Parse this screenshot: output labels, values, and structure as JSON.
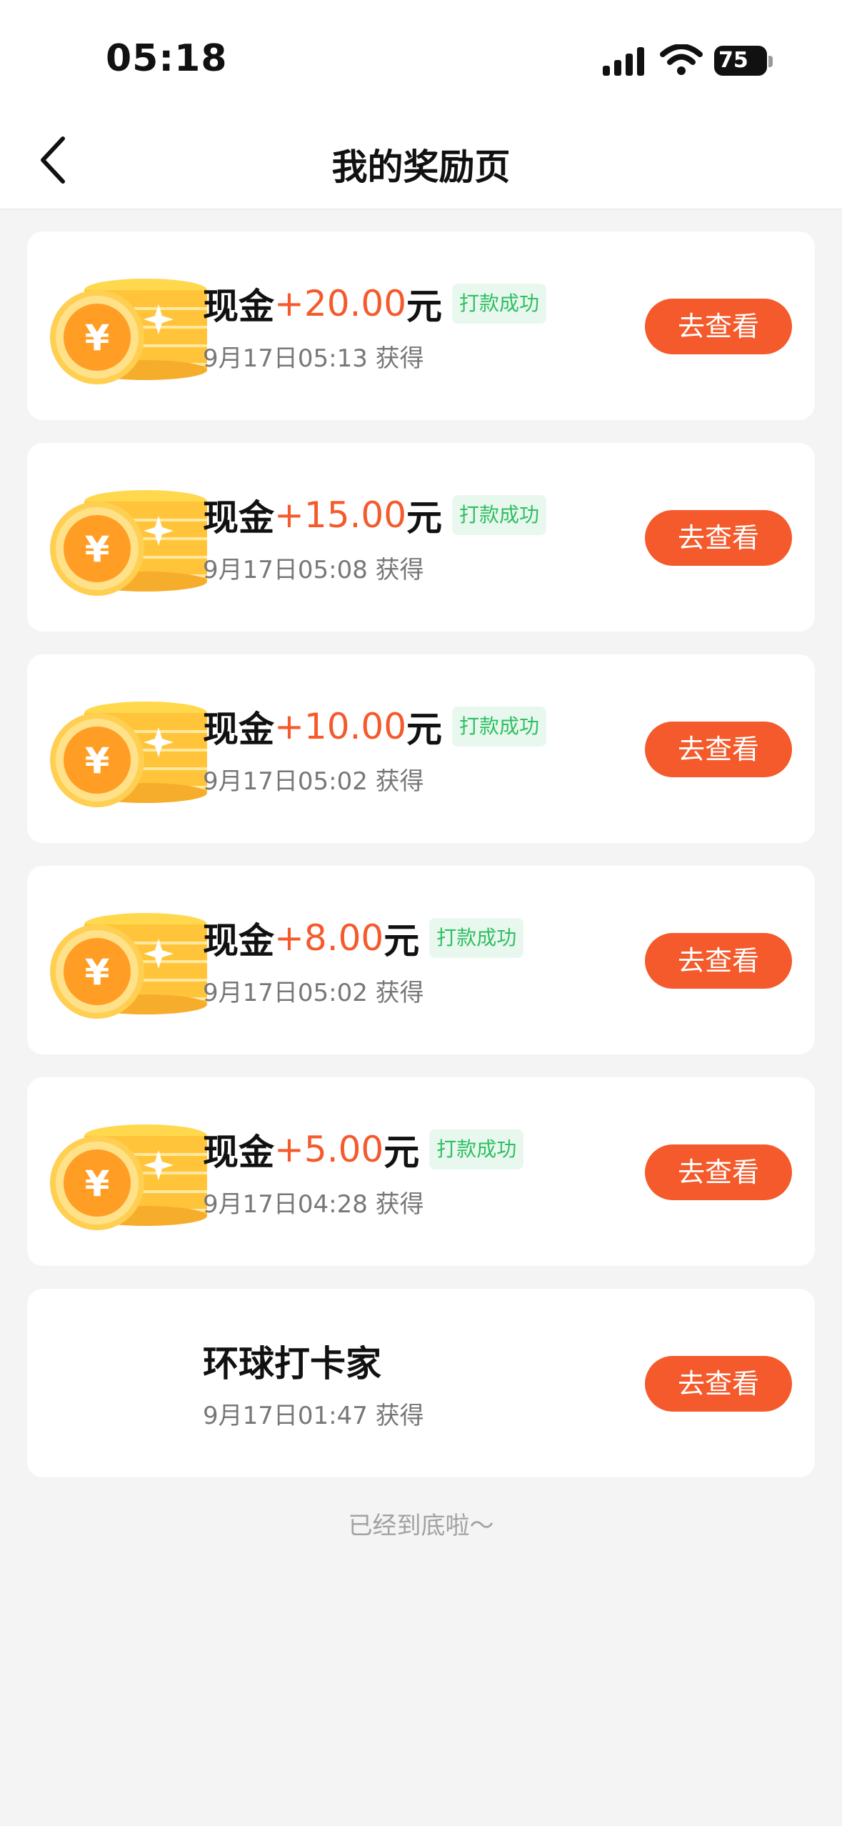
{
  "status_bar": {
    "time": "05:18",
    "battery_level": "75",
    "icons": [
      "signal-icon",
      "wifi-icon",
      "battery-icon"
    ]
  },
  "nav": {
    "title": "我的奖励页",
    "back_icon": "chevron-left-icon"
  },
  "colors": {
    "accent": "#f45a2b",
    "amount": "#f55a2c",
    "success_text": "#2fbf63",
    "success_bg": "#e9f8ee",
    "background": "#f4f4f4"
  },
  "rewards": [
    {
      "prefix": "现金",
      "amount": "+20.00",
      "suffix": "元",
      "status": "打款成功",
      "time": "9月17日05:13 获得",
      "button": "去查看",
      "icon": "gold-coin-icon"
    },
    {
      "prefix": "现金",
      "amount": "+15.00",
      "suffix": "元",
      "status": "打款成功",
      "time": "9月17日05:08 获得",
      "button": "去查看",
      "icon": "gold-coin-icon"
    },
    {
      "prefix": "现金",
      "amount": "+10.00",
      "suffix": "元",
      "status": "打款成功",
      "time": "9月17日05:02 获得",
      "button": "去查看",
      "icon": "gold-coin-icon"
    },
    {
      "prefix": "现金",
      "amount": "+8.00",
      "suffix": "元",
      "status": "打款成功",
      "time": "9月17日05:02 获得",
      "button": "去查看",
      "icon": "gold-coin-icon"
    },
    {
      "prefix": "现金",
      "amount": "+5.00",
      "suffix": "元",
      "status": "打款成功",
      "time": "9月17日04:28 获得",
      "button": "去查看",
      "icon": "gold-coin-icon"
    },
    {
      "title": "环球打卡家",
      "time": "9月17日01:47 获得",
      "button": "去查看"
    }
  ],
  "footer": "已经到底啦～"
}
